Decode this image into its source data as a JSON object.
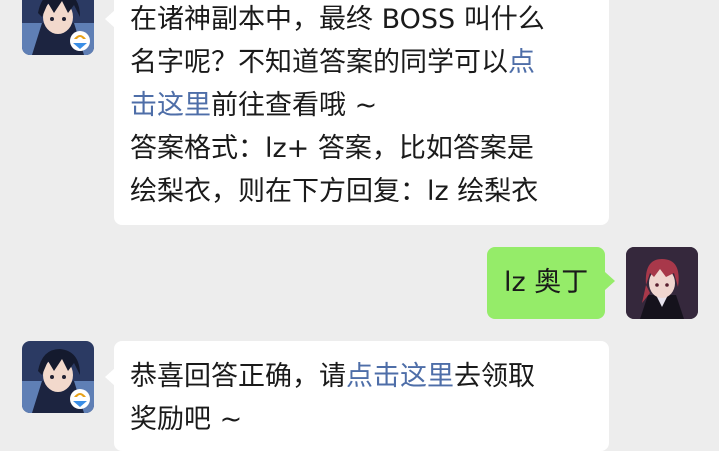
{
  "messages": [
    {
      "sender": "bot",
      "lines": [
        {
          "text": "在诸神副本中，最终 BOSS 叫什么"
        },
        {
          "text": "名字呢？不知道答案的同学可以",
          "link": "点"
        },
        {
          "link": "击这里",
          "text": "前往查看哦 ~"
        },
        {
          "text": "答案格式：lz+ 答案，比如答案是"
        },
        {
          "text": "绘梨衣，则在下方回复：lz 绘梨衣"
        }
      ]
    },
    {
      "sender": "user",
      "text": "lz 奥丁"
    },
    {
      "sender": "bot",
      "lines": [
        {
          "text": "恭喜回答正确，请",
          "link": "点击这里",
          "after": "去领取"
        },
        {
          "text": "奖励吧 ~"
        }
      ]
    }
  ],
  "colors": {
    "background": "#ededed",
    "bubble_left": "#ffffff",
    "bubble_right": "#95ec69",
    "link": "#4e6ea8"
  },
  "icons": {
    "bot_avatar": "anime-boy-avatar-with-game-logo-icon",
    "user_avatar": "anime-red-hair-avatar-icon"
  }
}
